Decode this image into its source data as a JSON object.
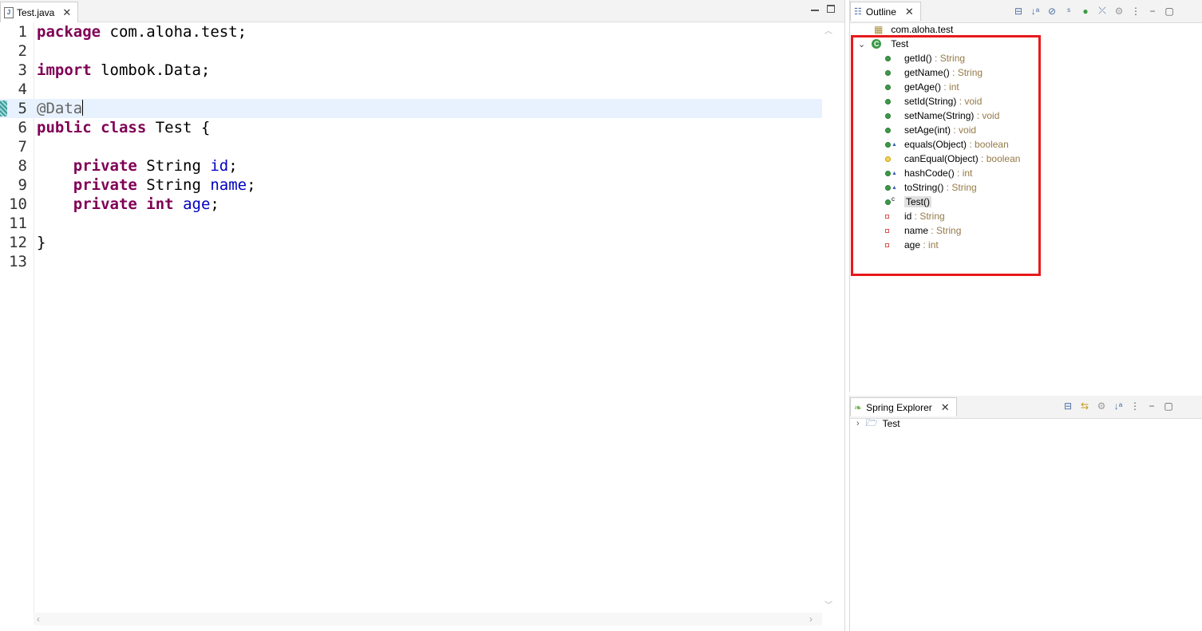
{
  "editor": {
    "tab_label": "Test.java",
    "lines": [
      {
        "num": "1",
        "parts": [
          {
            "t": "package",
            "c": "kw"
          },
          {
            "t": " com.aloha.test;",
            "c": ""
          }
        ]
      },
      {
        "num": "2",
        "parts": []
      },
      {
        "num": "3",
        "parts": [
          {
            "t": "import",
            "c": "kw"
          },
          {
            "t": " lombok.Data;",
            "c": ""
          }
        ]
      },
      {
        "num": "4",
        "parts": []
      },
      {
        "num": "5",
        "parts": [
          {
            "t": "@Data",
            "c": "ann"
          }
        ],
        "active": true
      },
      {
        "num": "6",
        "parts": [
          {
            "t": "public",
            "c": "kw"
          },
          {
            "t": " ",
            "c": ""
          },
          {
            "t": "class",
            "c": "kw"
          },
          {
            "t": " Test {",
            "c": ""
          }
        ]
      },
      {
        "num": "7",
        "parts": []
      },
      {
        "num": "8",
        "parts": [
          {
            "t": "    ",
            "c": ""
          },
          {
            "t": "private",
            "c": "kw"
          },
          {
            "t": " String ",
            "c": ""
          },
          {
            "t": "id",
            "c": "fld"
          },
          {
            "t": ";",
            "c": ""
          }
        ]
      },
      {
        "num": "9",
        "parts": [
          {
            "t": "    ",
            "c": ""
          },
          {
            "t": "private",
            "c": "kw"
          },
          {
            "t": " String ",
            "c": ""
          },
          {
            "t": "name",
            "c": "fld"
          },
          {
            "t": ";",
            "c": ""
          }
        ]
      },
      {
        "num": "10",
        "parts": [
          {
            "t": "    ",
            "c": ""
          },
          {
            "t": "private",
            "c": "kw"
          },
          {
            "t": " ",
            "c": ""
          },
          {
            "t": "int",
            "c": "kw"
          },
          {
            "t": " ",
            "c": ""
          },
          {
            "t": "age",
            "c": "fld"
          },
          {
            "t": ";",
            "c": ""
          }
        ]
      },
      {
        "num": "11",
        "parts": []
      },
      {
        "num": "12",
        "parts": [
          {
            "t": "}",
            "c": ""
          }
        ]
      },
      {
        "num": "13",
        "parts": []
      }
    ]
  },
  "outline": {
    "tab_label": "Outline",
    "package": "com.aloha.test",
    "class_name": "Test",
    "members": [
      {
        "name": "getId()",
        "ret": " : String",
        "icon": "public-method"
      },
      {
        "name": "getName()",
        "ret": " : String",
        "icon": "public-method"
      },
      {
        "name": "getAge()",
        "ret": " : int",
        "icon": "public-method"
      },
      {
        "name": "setId(String)",
        "ret": " : void",
        "icon": "public-method"
      },
      {
        "name": "setName(String)",
        "ret": " : void",
        "icon": "public-method"
      },
      {
        "name": "setAge(int)",
        "ret": " : void",
        "icon": "public-method"
      },
      {
        "name": "equals(Object)",
        "ret": " : boolean",
        "icon": "override-method"
      },
      {
        "name": "canEqual(Object)",
        "ret": " : boolean",
        "icon": "protected-method"
      },
      {
        "name": "hashCode()",
        "ret": " : int",
        "icon": "override-method"
      },
      {
        "name": "toString()",
        "ret": " : String",
        "icon": "override-method"
      },
      {
        "name": "Test()",
        "ret": "",
        "icon": "constructor"
      },
      {
        "name": "id",
        "ret": " : String",
        "icon": "private-field"
      },
      {
        "name": "name",
        "ret": " : String",
        "icon": "private-field"
      },
      {
        "name": "age",
        "ret": " : int",
        "icon": "private-field"
      }
    ]
  },
  "spring": {
    "tab_label": "Spring Explorer",
    "items": [
      {
        "label": "Test"
      }
    ]
  },
  "colors": {
    "highlight": "#e8191c",
    "keyword": "#7f0055",
    "field": "#0000c0"
  }
}
